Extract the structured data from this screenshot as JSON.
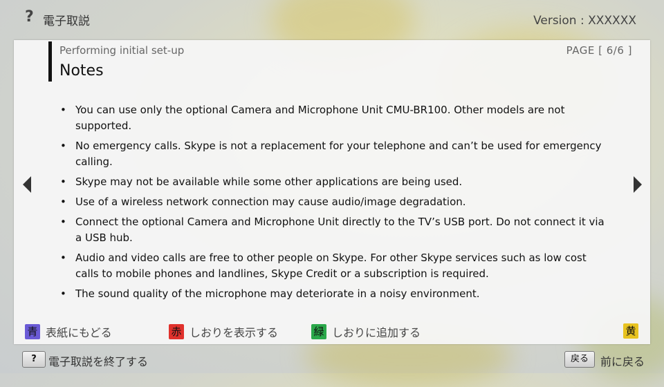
{
  "header": {
    "help_glyph": "?",
    "app_title": "電子取説",
    "version": "Version : XXXXXX"
  },
  "panel": {
    "breadcrumb": "Performing initial set-up",
    "page_indicator": "PAGE [ 6/6 ]",
    "title": "Notes",
    "bullet": "•",
    "notes": [
      "You can use only the optional Camera and Microphone Unit CMU-BR100. Other models are not supported.",
      "No emergency calls. Skype is not a replacement for your telephone and can’t be used for emergency calling.",
      "Skype may not be available while some other applications are being used.",
      "Use of a wireless network connection may cause audio/image degradation.",
      "Connect the optional Camera and Microphone Unit directly to the TV’s USB port. Do not connect it via a USB hub.",
      "Audio and video calls are free to other people on Skype. For other Skype services such as low cost calls to mobile phones and landlines, Skype Credit or a subscription is required.",
      "The sound quality of the microphone may deteriorate in a noisy environment."
    ]
  },
  "legend": {
    "blue_key": "青",
    "blue_label": "表紙にもどる",
    "red_key": "赤",
    "red_label": "しおりを表示する",
    "green_key": "緑",
    "green_label": "しおりに追加する",
    "yellow_key": "黄"
  },
  "footer": {
    "help_key": "?",
    "help_label": "電子取説を終了する",
    "back_key": "戻る",
    "back_label": "前に戻る"
  },
  "colors": {
    "blue": "#6a5ad6",
    "red": "#e0312c",
    "green": "#2aa84a",
    "yellow": "#e8c320"
  },
  "icons": {
    "nav_prev": "arrow-left-icon",
    "nav_next": "arrow-right-icon"
  }
}
